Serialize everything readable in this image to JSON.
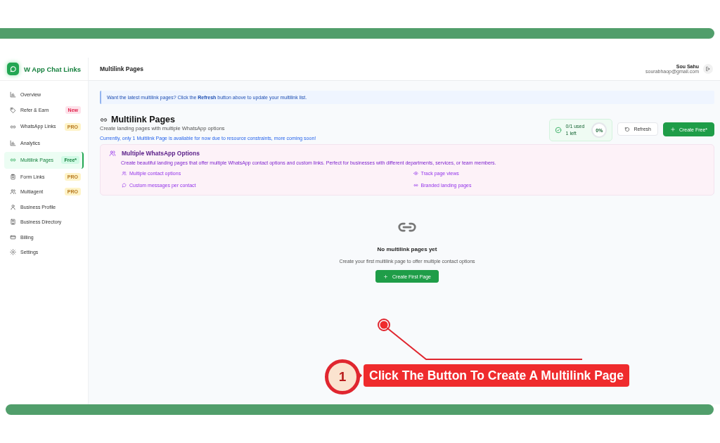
{
  "sidebar": {
    "brand": "W App Chat Links",
    "items": [
      {
        "label": "Overview",
        "selected": false
      },
      {
        "label": "Refer & Earn",
        "selected": false,
        "badge": {
          "kind": "new",
          "text": "New"
        }
      },
      {
        "label": "WhatsApp Links",
        "selected": false,
        "badge": {
          "kind": "pro",
          "text": "PRO"
        }
      },
      {
        "label": "Analytics",
        "selected": false
      },
      {
        "label": "Multilink Pages",
        "selected": true,
        "badge": {
          "kind": "free",
          "text": "Free*"
        }
      },
      {
        "label": "Form Links",
        "selected": false,
        "badge": {
          "kind": "pro",
          "text": "PRO"
        }
      },
      {
        "label": "Multiagent",
        "selected": false,
        "badge": {
          "kind": "pro",
          "text": "PRO"
        }
      },
      {
        "label": "Business Profile",
        "selected": false
      },
      {
        "label": "Business Directory",
        "selected": false
      },
      {
        "label": "Billing",
        "selected": false
      },
      {
        "label": "Settings",
        "selected": false
      }
    ]
  },
  "header": {
    "title": "Multilink Pages",
    "user_name": "Sou Sahu",
    "user_email": "sourabhaop@gmail.com"
  },
  "banner": "Want the latest multilink pages? Click the **Refresh** button above to update your multilink list.",
  "page": {
    "title": "Multilink Pages",
    "subtitle": "Create landing pages with multiple WhatsApp options",
    "notice": "Currently, only 1 Multilink Page is available for now due to resource constraints, more coming soon!"
  },
  "usage": {
    "used": "0/1 used",
    "left": "1 left",
    "percent": "0%"
  },
  "buttons": [
    {
      "label": "Refresh",
      "kind": "outline"
    },
    {
      "label": "Create Free*",
      "kind": "primary"
    }
  ],
  "features": {
    "title": "Multiple WhatsApp Options",
    "description": "Create beautiful landing pages that offer multiple WhatsApp contact options and custom links. Perfect for businesses with different departments, services, or team members.",
    "items": [
      {
        "label": "Multiple contact options"
      },
      {
        "label": "Track page views"
      },
      {
        "label": "Custom messages per contact"
      },
      {
        "label": "Branded landing pages"
      }
    ]
  },
  "empty": {
    "title": "No multilink pages yet",
    "text": "Create your first multilink page to offer multiple contact options",
    "button": "Create First Page"
  },
  "annotation": {
    "number": "1",
    "text": "Click The Button To Create A Multilink Page"
  }
}
